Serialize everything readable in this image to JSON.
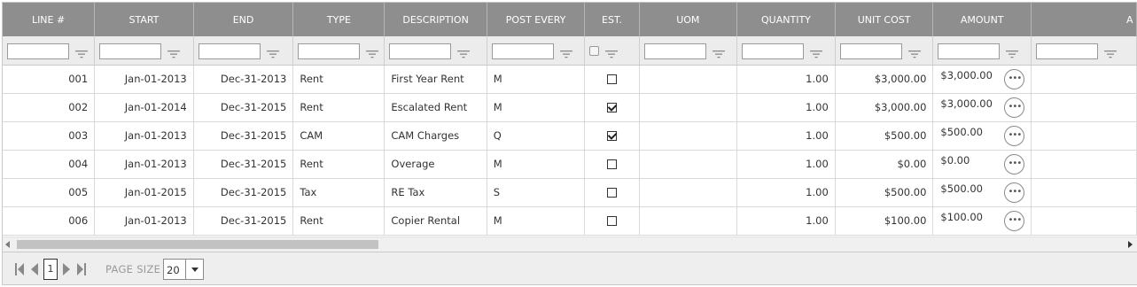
{
  "columns": [
    "LINE #",
    "START",
    "END",
    "TYPE",
    "DESCRIPTION",
    "POST EVERY",
    "EST.",
    "UOM",
    "QUANTITY",
    "UNIT COST",
    "AMOUNT",
    "A"
  ],
  "rows": [
    {
      "line": "001",
      "start": "Jan-01-2013",
      "end": "Dec-31-2013",
      "type": "Rent",
      "description": "First Year Rent",
      "post_every": "M",
      "est": false,
      "uom": "",
      "quantity": "1.00",
      "unit_cost": "$3,000.00",
      "amount": "$3,000.00"
    },
    {
      "line": "002",
      "start": "Jan-01-2014",
      "end": "Dec-31-2015",
      "type": "Rent",
      "description": "Escalated Rent",
      "post_every": "M",
      "est": true,
      "uom": "",
      "quantity": "1.00",
      "unit_cost": "$3,000.00",
      "amount": "$3,000.00"
    },
    {
      "line": "003",
      "start": "Jan-01-2013",
      "end": "Dec-31-2015",
      "type": "CAM",
      "description": "CAM Charges",
      "post_every": "Q",
      "est": true,
      "uom": "",
      "quantity": "1.00",
      "unit_cost": "$500.00",
      "amount": "$500.00"
    },
    {
      "line": "004",
      "start": "Jan-01-2013",
      "end": "Dec-31-2015",
      "type": "Rent",
      "description": "Overage",
      "post_every": "M",
      "est": false,
      "uom": "",
      "quantity": "1.00",
      "unit_cost": "$0.00",
      "amount": "$0.00"
    },
    {
      "line": "005",
      "start": "Jan-01-2015",
      "end": "Dec-31-2015",
      "type": "Tax",
      "description": "RE Tax",
      "post_every": "S",
      "est": false,
      "uom": "",
      "quantity": "1.00",
      "unit_cost": "$500.00",
      "amount": "$500.00"
    },
    {
      "line": "006",
      "start": "Jan-01-2013",
      "end": "Dec-31-2015",
      "type": "Rent",
      "description": "Copier Rental",
      "post_every": "M",
      "est": false,
      "uom": "",
      "quantity": "1.00",
      "unit_cost": "$100.00",
      "amount": "$100.00"
    }
  ],
  "row_action_icon": "more-horizontal-icon",
  "filter_icon": "filter-icon",
  "pager": {
    "current_page": "1",
    "page_size_label": "PAGE SIZE",
    "page_size": "20"
  },
  "colors": {
    "header_bg": "#8e8e8e",
    "filter_bg": "#ececec",
    "pager_bg": "#eeeeee"
  }
}
